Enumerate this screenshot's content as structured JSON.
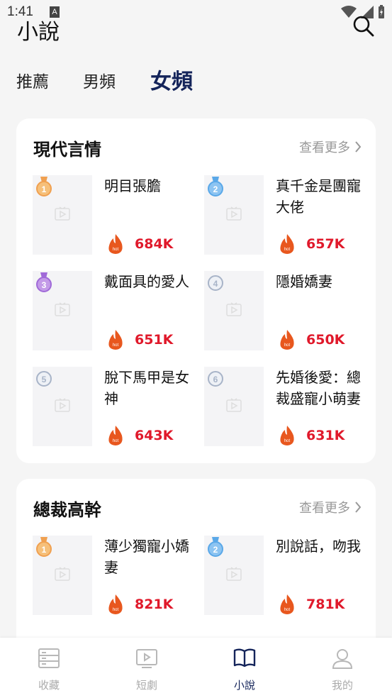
{
  "status_bar": {
    "time": "1:41",
    "notif": "A"
  },
  "header": {
    "title": "小說"
  },
  "tabs": [
    {
      "label": "推薦"
    },
    {
      "label": "男頻"
    },
    {
      "label": "女頻",
      "active": true
    }
  ],
  "sections": [
    {
      "title": "現代言情",
      "more": "查看更多",
      "items": [
        {
          "rank": "1",
          "title": "明目張膽",
          "count": "684K"
        },
        {
          "rank": "2",
          "title": "真千金是團寵大佬",
          "count": "657K"
        },
        {
          "rank": "3",
          "title": "戴面具的愛人",
          "count": "651K"
        },
        {
          "rank": "4",
          "title": "隱婚嬌妻",
          "count": "650K"
        },
        {
          "rank": "5",
          "title": "脫下馬甲是女神",
          "count": "643K"
        },
        {
          "rank": "6",
          "title": "先婚後愛：總裁盛寵小萌妻",
          "count": "631K"
        }
      ]
    },
    {
      "title": "總裁高幹",
      "more": "查看更多",
      "items": [
        {
          "rank": "1",
          "title": "薄少獨寵小嬌妻",
          "count": "821K"
        },
        {
          "rank": "2",
          "title": "別說話，吻我",
          "count": "781K"
        }
      ]
    }
  ],
  "bottom_nav": [
    {
      "label": "收藏",
      "icon": "bookshelf-icon"
    },
    {
      "label": "短劇",
      "icon": "video-icon"
    },
    {
      "label": "小說",
      "icon": "book-icon",
      "active": true
    },
    {
      "label": "我的",
      "icon": "profile-icon"
    }
  ],
  "colors": {
    "accent": "#14245a",
    "hot": "#e0192b",
    "gold": "#f0a050",
    "silver": "#5aa8e8",
    "bronze": "#a06ad8",
    "plain": "#a8b4c8"
  }
}
